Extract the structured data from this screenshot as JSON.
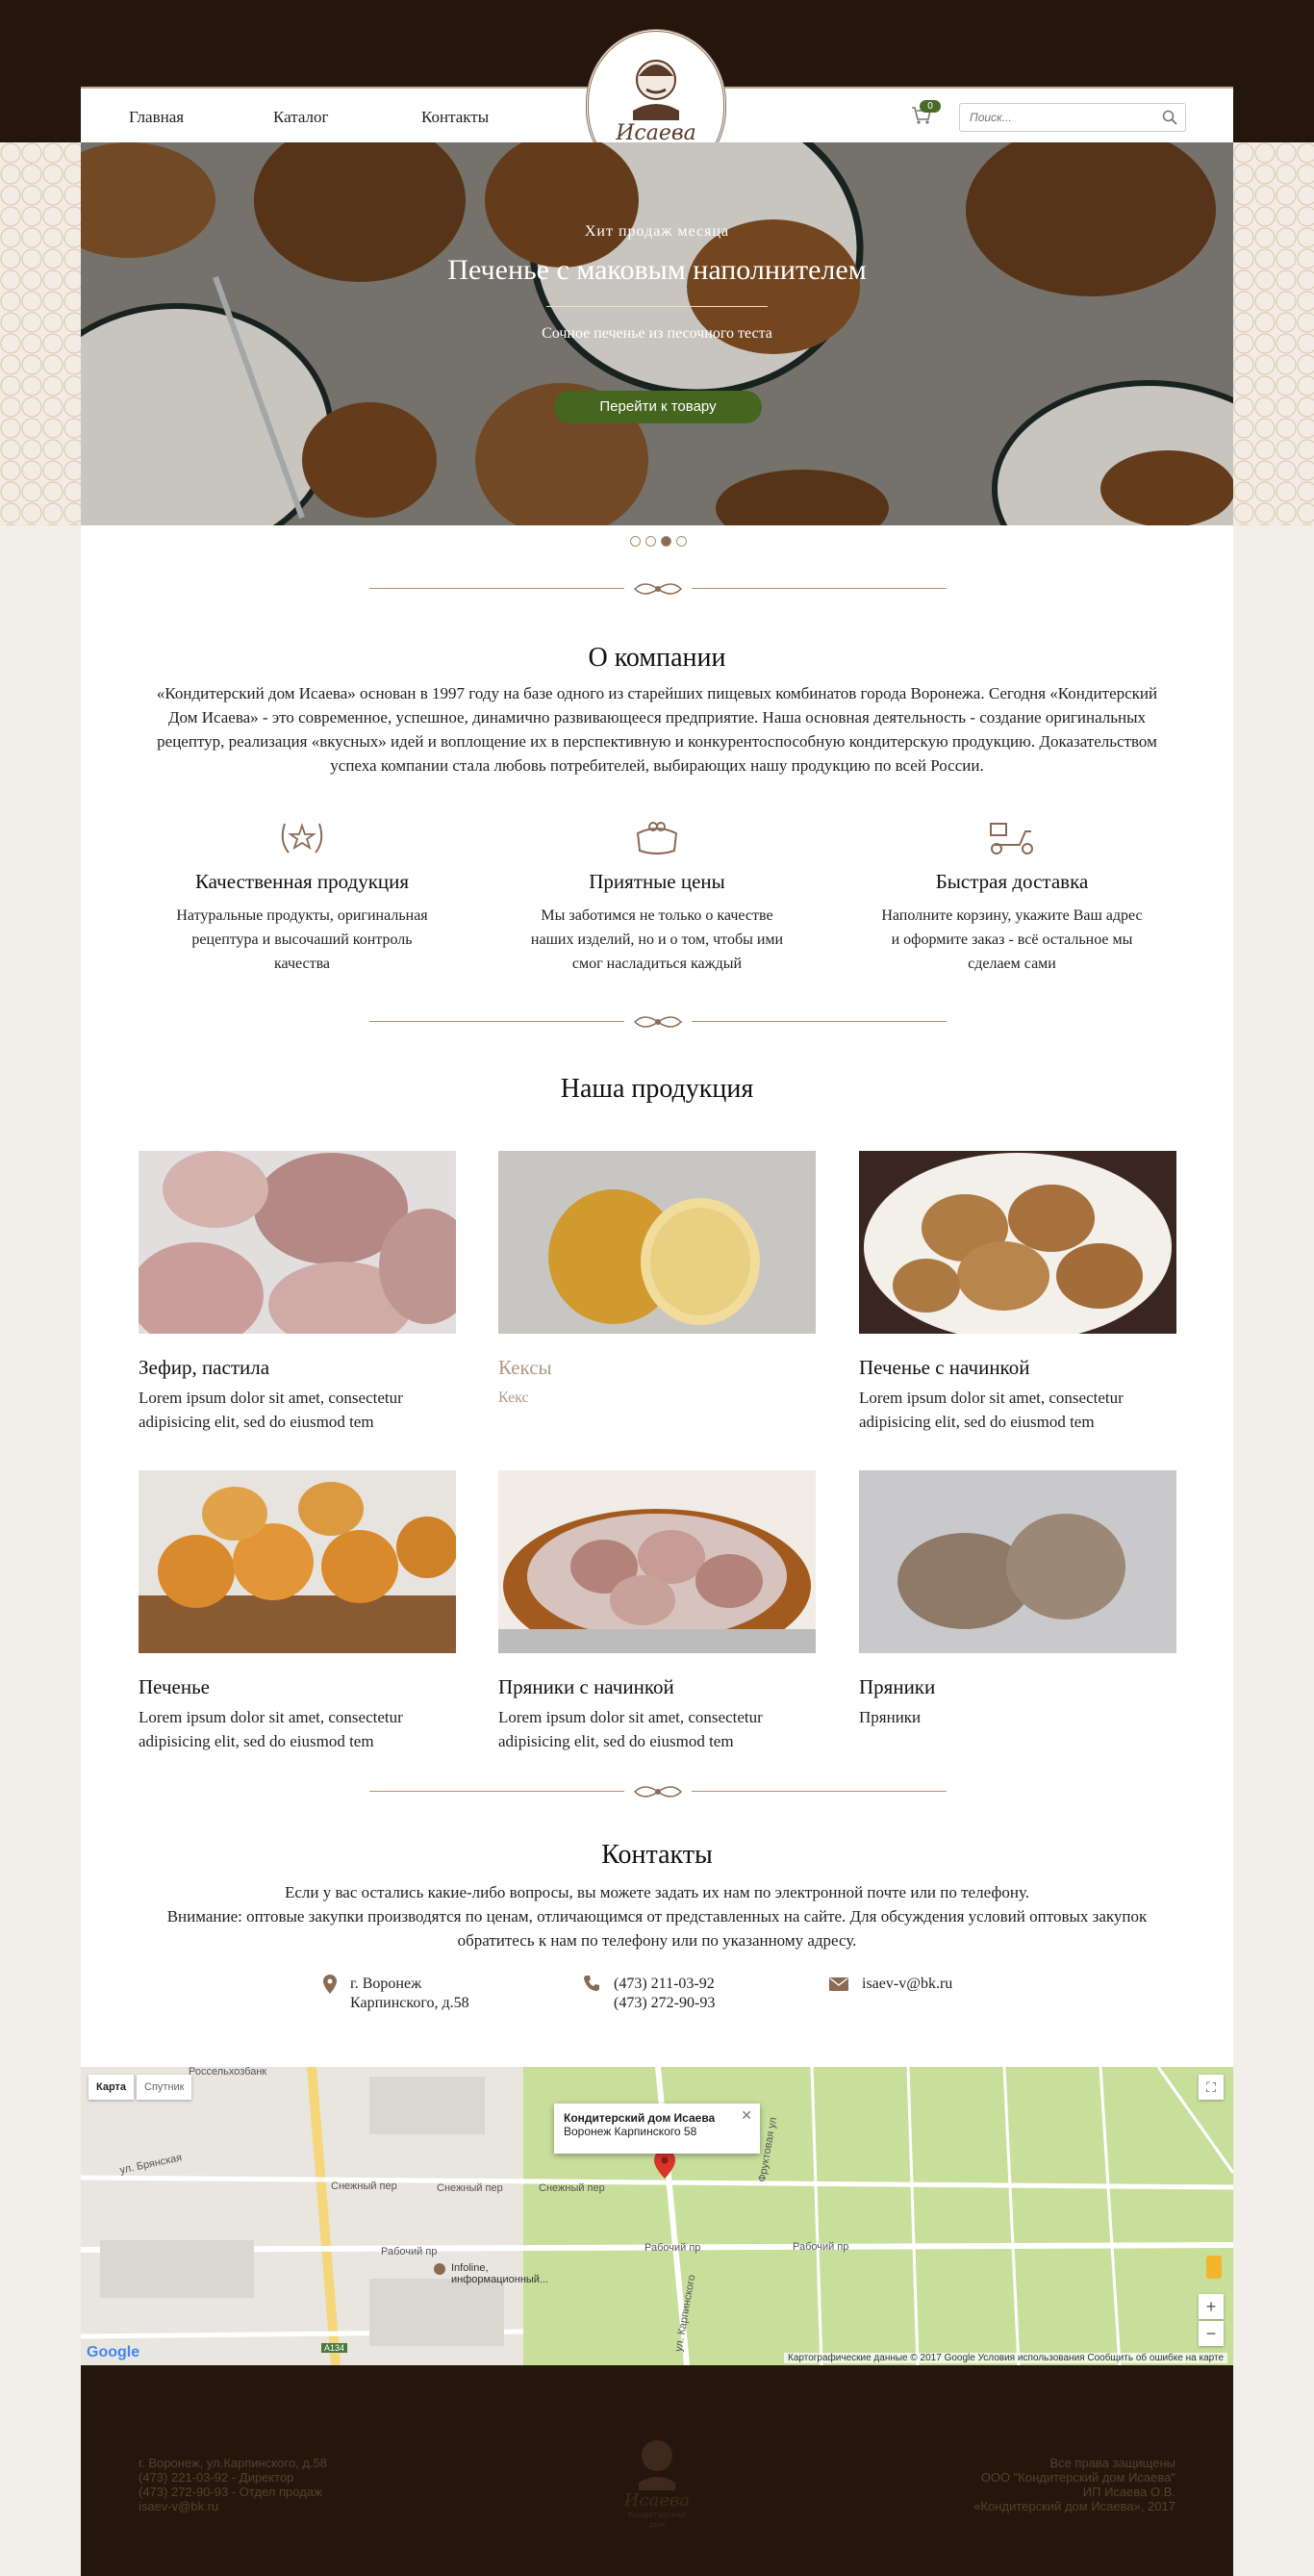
{
  "nav": {
    "home": "Главная",
    "catalog": "Каталог",
    "contacts": "Контакты",
    "cart_count": "0",
    "search_placeholder": "Поиск..."
  },
  "logo": {
    "brand": "Исаева",
    "line1": "Кондитерский",
    "line2": "дом"
  },
  "hero": {
    "kicker": "Хит продаж месяца",
    "title": "Печенье с маковым наполнителем",
    "subtitle": "Сочное печенье из песочного теста",
    "button": "Перейти к товару",
    "slides": 4,
    "active_slide": 3
  },
  "about": {
    "title": "О компании",
    "text": "«Кондитерский дом Исаева» основан в 1997 году на базе одного из старейших пищевых комбинатов города Воронежа. Сегодня «Кондитерский Дом Исаева» - это современное, успешное, динамично развивающееся предприятие. Наша основная деятельность - создание оригинальных рецептур, реализация «вкусных» идей и воплощение их в перспективную и конкурентоспособную кондитерскую продукцию. Доказательством успеха компании стала любовь потребителей, выбирающих нашу продукцию по всей России."
  },
  "features": [
    {
      "icon": "laurel-star-icon",
      "title": "Качественная продукция",
      "text": "Натуральные продукты, оригинальная рецептура и высочаший контроль качества"
    },
    {
      "icon": "purse-icon",
      "title": "Приятные цены",
      "text": "Мы заботимся не только о качестве наших изделий, но и о том, чтобы ими смог насладиться каждый"
    },
    {
      "icon": "scooter-icon",
      "title": "Быстрая доставка",
      "text": "Наполните корзину, укажите Ваш адрес и оформите заказ - всё остальное мы сделаем сами"
    }
  ],
  "products": {
    "title": "Наша продукция",
    "items": [
      {
        "name": "Зефир, пастила",
        "desc": "Lorem ipsum dolor sit amet, consectetur adipisicing elit, sed do eiusmod tem"
      },
      {
        "name": "Кексы",
        "desc": "Кекс"
      },
      {
        "name": "Печенье с начинкой",
        "desc": "Lorem ipsum dolor sit amet, consectetur adipisicing elit, sed do eiusmod tem"
      },
      {
        "name": "Печенье",
        "desc": "Lorem ipsum dolor sit amet, consectetur adipisicing elit, sed do eiusmod tem"
      },
      {
        "name": "Пряники с начинкой",
        "desc": "Lorem ipsum dolor sit amet, consectetur adipisicing elit, sed do eiusmod tem"
      },
      {
        "name": "Пряники",
        "desc": "Пряники"
      }
    ]
  },
  "contacts": {
    "title": "Контакты",
    "line1": "Если у вас остались какие-либо вопросы, вы можете задать их нам по электронной почте или по телефону.",
    "line2": "Внимание: оптовые закупки производятся по ценам, отличающимся от представленных на сайте. Для обсуждения условий оптовых закупок обратитесь к нам по телефону или по указанному адресу.",
    "address1": "г. Воронеж",
    "address2": "Карпинского, д.58",
    "phone1": "(473) 211-03-92",
    "phone2": "(473) 272-90-93",
    "email": "isaev-v@bk.ru"
  },
  "map": {
    "tab_map": "Карта",
    "tab_sat": "Спутник",
    "popup_title": "Кондитерский дом Исаева",
    "popup_addr": "Воронеж Карпинского 58",
    "labels": {
      "bank": "Россельхозбанк",
      "bryanskaya": "ул. Брянская",
      "snezhny1": "Снежный пер",
      "snezhny2": "Снежный пер",
      "snezhny3": "Снежный пер",
      "rabochiy1": "Рабочий пр",
      "rabochiy2": "Рабочий пр",
      "rabochiy3": "Рабочий пр",
      "infoline": "Infoline, информационный...",
      "karpinskogo": "ул. Карпинского",
      "frunze": "Фруктовая ул",
      "a134": "А134",
      "google": "Google"
    },
    "footer": "Картографические данные © 2017 Google   Условия использования   Сообщить об ошибке на карте"
  },
  "footer": {
    "left1": "г. Воронеж, ул.Карпинского, д.58",
    "left2": "(473) 221-03-92 - Директор",
    "left3": "(473) 272-90-93 - Отдел продаж",
    "left4": "isaev-v@bk.ru",
    "right1": "Все права защищены",
    "right2": "ООО \"Кондитерский дом Исаева\"",
    "right3": "ИП Исаева О.В.",
    "right4": "«Кондитерский дом Исаева», 2017"
  },
  "colors": {
    "dark_brown": "#25160d",
    "accent_green": "#45661f",
    "gold": "#b78f6c"
  }
}
